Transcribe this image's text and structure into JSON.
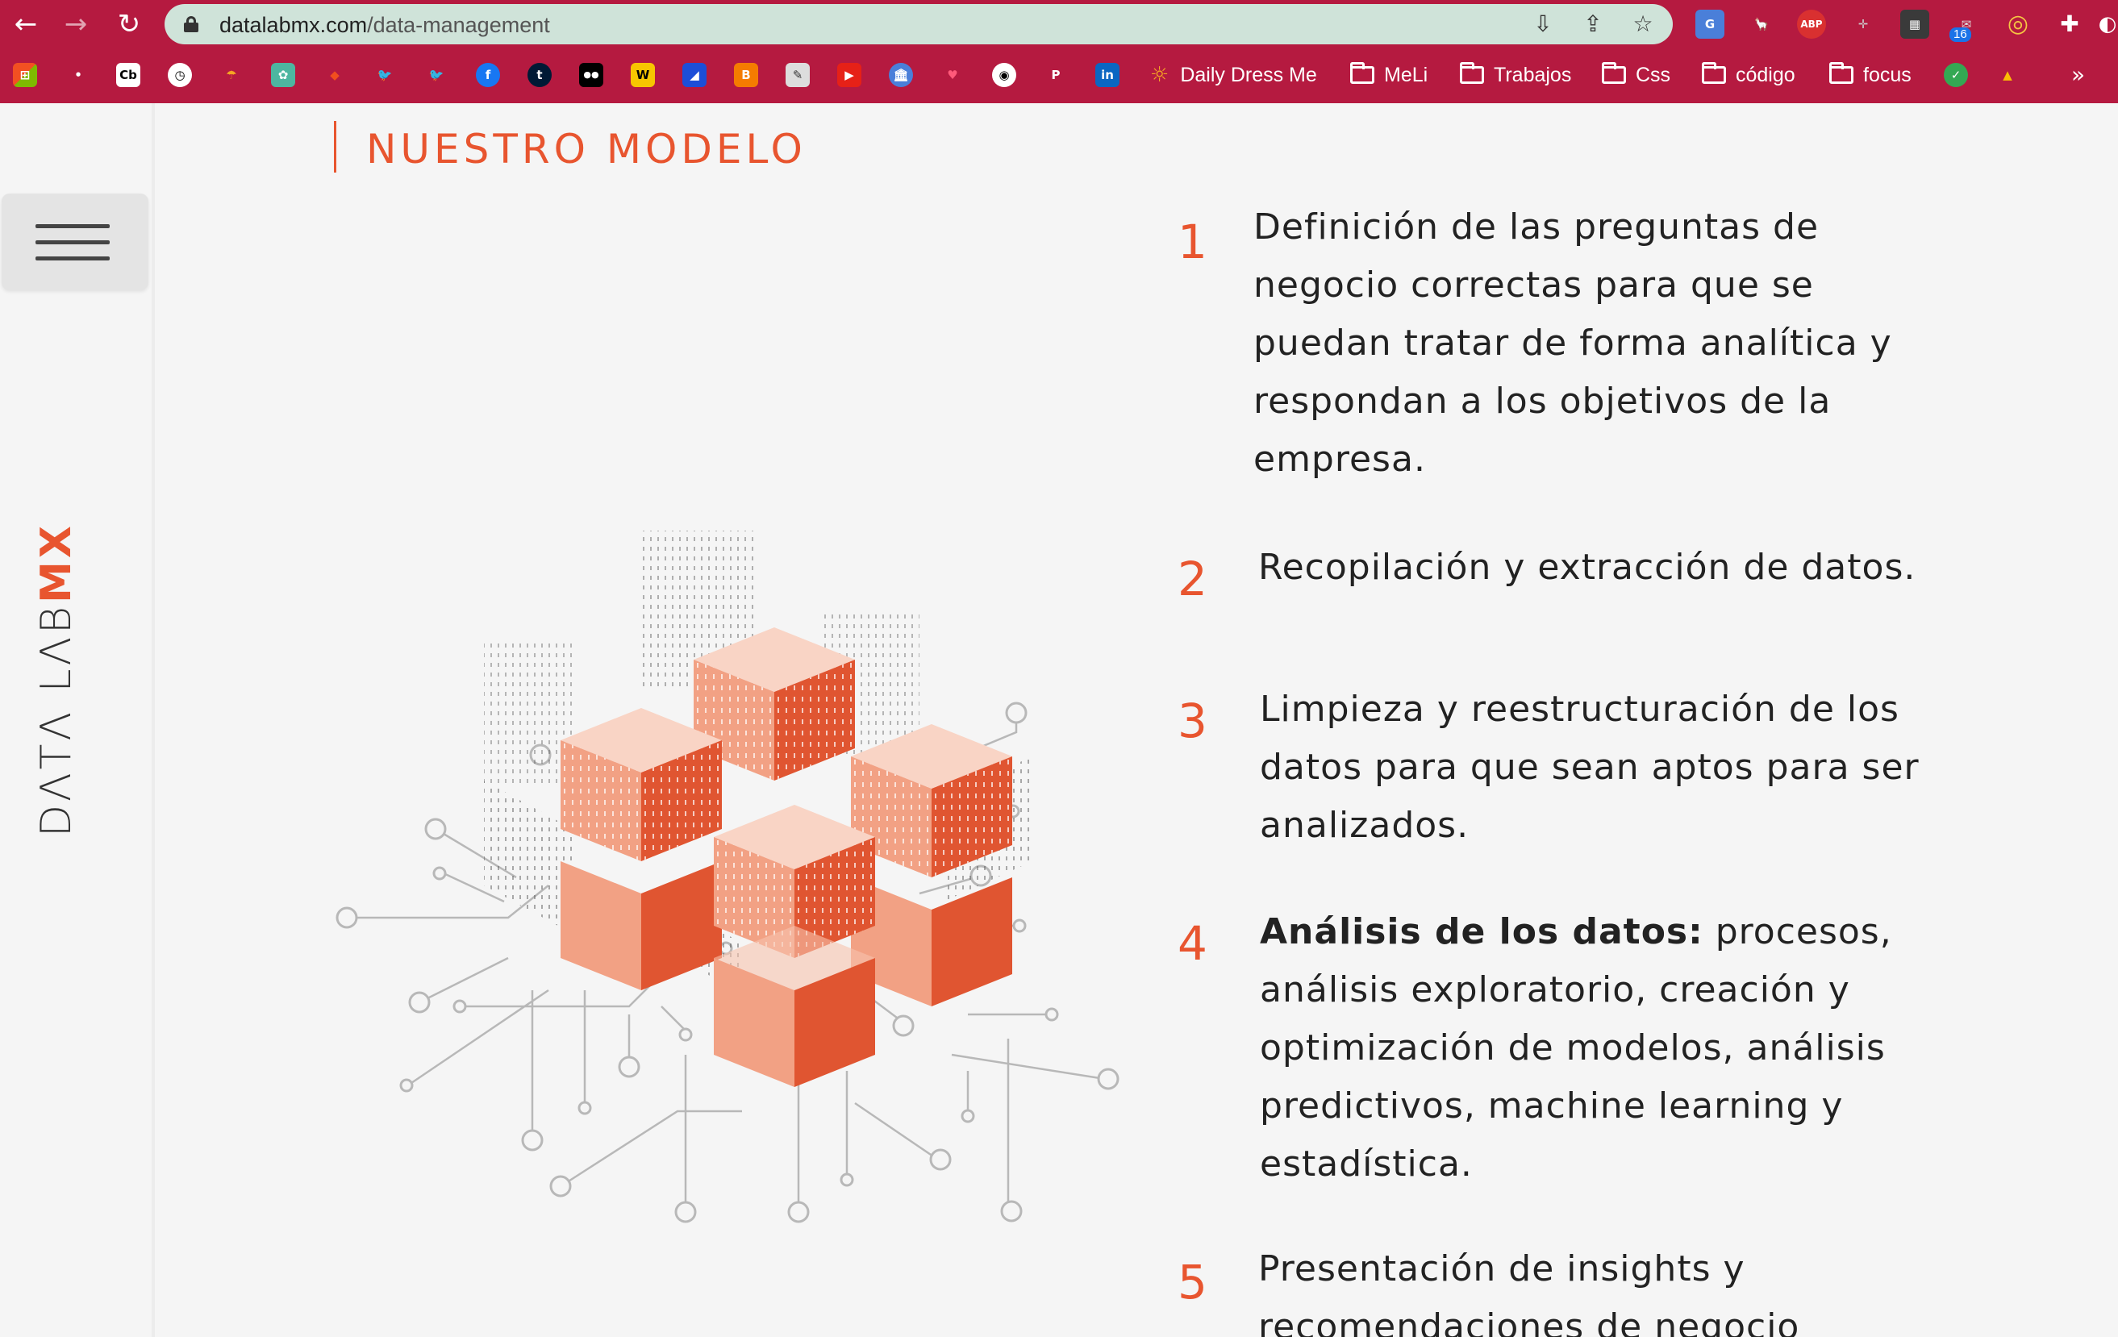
{
  "browser": {
    "back_glyph": "←",
    "forward_glyph": "→",
    "reload_glyph": "↻",
    "url_host": "datalabmx.com",
    "url_path": "/data-management",
    "install_glyph": "⇩",
    "share_glyph": "⇪",
    "star_glyph": "☆",
    "extensions": [
      "G",
      "🦙",
      "ABP",
      "✛",
      "▦",
      "✉",
      "◎",
      "✚",
      "◐"
    ],
    "mail_badge": "16",
    "bookmark_overflow": "»"
  },
  "bookmarks": {
    "icons": [
      "⊞",
      "•",
      "Cb",
      "◷",
      "☂",
      "✿",
      "◆",
      "🐦",
      "🐦",
      "f",
      "t",
      "●●",
      "W",
      "◢",
      "B",
      "✎",
      "▶",
      "🏛",
      "♥",
      "◉",
      "P",
      "in"
    ],
    "items": [
      {
        "label": "Daily Dress Me"
      },
      {
        "label": "MeLi"
      },
      {
        "label": "Trabajos"
      },
      {
        "label": "Css"
      },
      {
        "label": "código"
      },
      {
        "label": "focus"
      }
    ],
    "trailing_icons": [
      "✓",
      "▲"
    ]
  },
  "sidebar": {
    "brand_main": "DΛTΛ LΛB",
    "brand_accent": "MX"
  },
  "main": {
    "heading": "NUESTRO MODELO",
    "steps": [
      {
        "number": "1",
        "bold": "",
        "text": "Definición de las preguntas de negocio correctas para que se puedan tratar de forma analítica y respondan a los objetivos de la empresa."
      },
      {
        "number": "2",
        "bold": "",
        "text": "Recopilación y extracción de datos."
      },
      {
        "number": "3",
        "bold": "",
        "text": "Limpieza y reestructuración de los datos para que sean aptos para ser analizados."
      },
      {
        "number": "4",
        "bold": "Análisis de los datos:",
        "text": " procesos, análisis exploratorio, creación y optimización de modelos, análisis predictivos, machine learning y estadística."
      },
      {
        "number": "5",
        "bold": "",
        "text": "Presentación de insights y recomendaciones de negocio"
      }
    ]
  },
  "colors": {
    "chrome": "#b51a40",
    "accent": "#e8552f",
    "cube_light": "#f2a184",
    "cube_top": "#f9d4c5",
    "cube_dark": "#e05531"
  }
}
